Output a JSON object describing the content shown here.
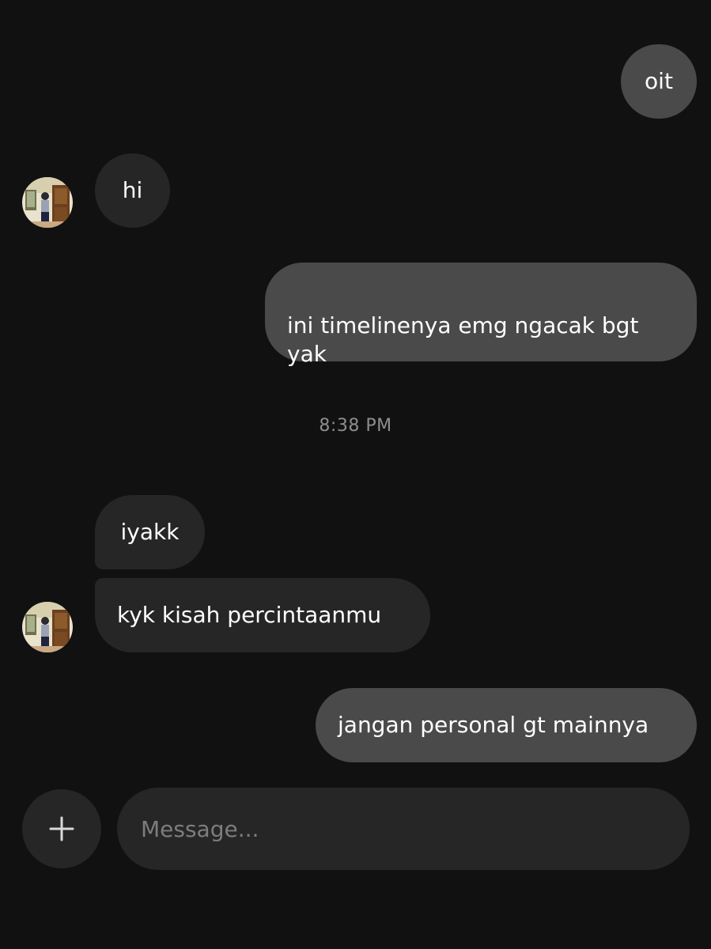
{
  "messages": [
    {
      "text": "oit"
    },
    {
      "text": "hi"
    },
    {
      "text": "ini timelinenya emg ngacak bgt\nyak"
    },
    {
      "text": "iyakk"
    },
    {
      "text": "kyk kisah percintaanmu"
    },
    {
      "text": "jangan personal gt mainnya"
    }
  ],
  "timestamp": "8:38 PM",
  "composer": {
    "add_icon": "plus-icon",
    "placeholder": "Message..."
  },
  "colors": {
    "background": "#111111",
    "outgoing_bubble": "#4a4a4a",
    "incoming_bubble": "#262626",
    "timestamp": "#8e8e8e"
  }
}
